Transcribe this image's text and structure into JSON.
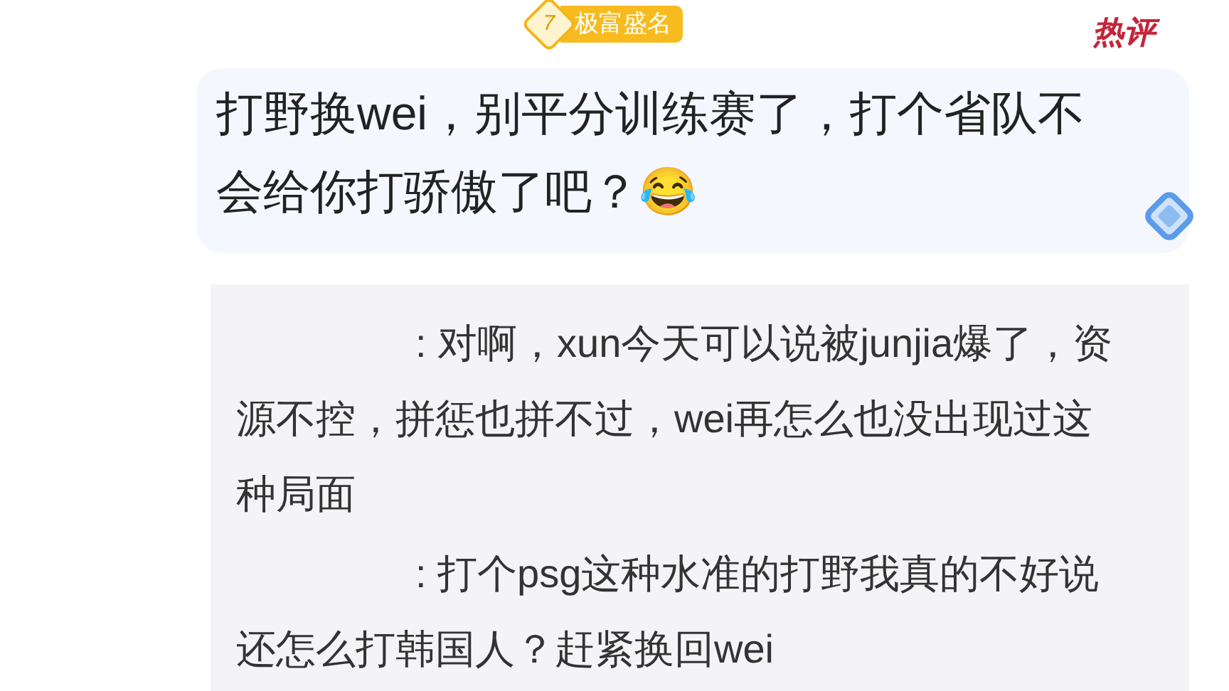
{
  "badge": {
    "level": "7",
    "label": "极富盛名"
  },
  "hot_tag": "热评",
  "comment": {
    "text": "打野换wei，别平分训练赛了，打个省队不会给你打骄傲了吧？😂"
  },
  "replies": [
    {
      "text": ": 对啊，xun今天可以说被junjia爆了，资源不控，拼惩也拼不过，wei再怎么也没出现过这种局面"
    },
    {
      "text": ": 打个psg这种水准的打野我真的不好说还怎么打韩国人？赶紧换回wei"
    }
  ]
}
